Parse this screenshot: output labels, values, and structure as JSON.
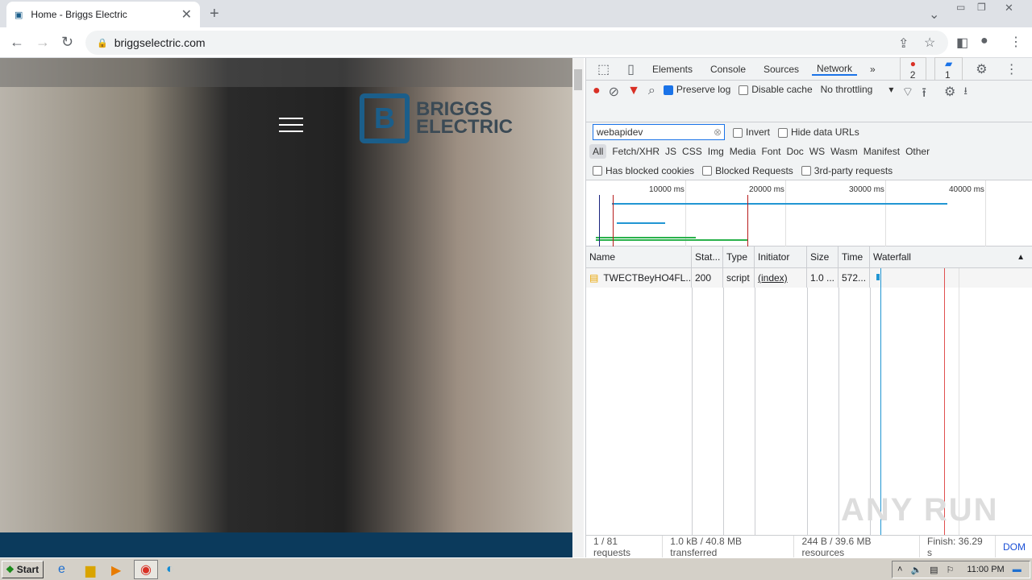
{
  "browser": {
    "tab_title": "Home - Briggs Electric",
    "url": "briggselectric.com"
  },
  "site": {
    "logo_line1": "BRIGGS",
    "logo_line2": "ELECTRIC",
    "logo_mark": "B"
  },
  "devtools": {
    "tabs": [
      "Elements",
      "Console",
      "Sources",
      "Network"
    ],
    "errors": "2",
    "messages": "1",
    "preserve_log": "Preserve log",
    "disable_cache": "Disable cache",
    "throttling": "No throttling",
    "filter_value": "webapidev",
    "invert": "Invert",
    "hide_data_urls": "Hide data URLs",
    "types": [
      "All",
      "Fetch/XHR",
      "JS",
      "CSS",
      "Img",
      "Media",
      "Font",
      "Doc",
      "WS",
      "Wasm",
      "Manifest",
      "Other"
    ],
    "has_blocked_cookies": "Has blocked cookies",
    "blocked_requests": "Blocked Requests",
    "third_party": "3rd-party requests",
    "ticks": [
      "10000 ms",
      "20000 ms",
      "30000 ms",
      "40000 ms"
    ],
    "columns": [
      "Name",
      "Stat...",
      "Type",
      "Initiator",
      "Size",
      "Time",
      "Waterfall"
    ],
    "rows": [
      {
        "name": "TWECTBeyHO4FL...",
        "status": "200",
        "type": "script",
        "initiator": "(index)",
        "size": "1.0 ...",
        "time": "572..."
      }
    ],
    "status": {
      "requests": "1 / 81 requests",
      "transferred": "1.0 kB / 40.8 MB transferred",
      "resources": "244 B / 39.6 MB resources",
      "finish": "Finish: 36.29 s",
      "dom": "DOM"
    }
  },
  "taskbar": {
    "start": "Start",
    "clock": "11:00 PM"
  },
  "watermark": "ANY RUN"
}
